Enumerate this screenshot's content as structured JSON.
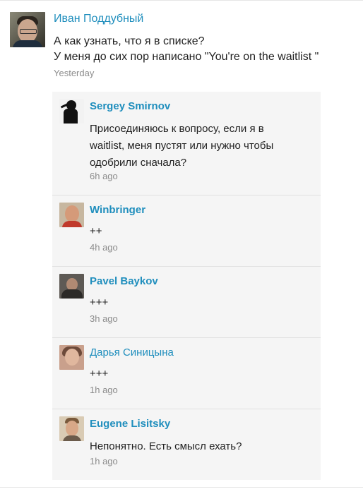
{
  "post": {
    "author": "Иван Поддубный",
    "lines": [
      "А как узнать, что я в списке?",
      "У меня до сих пор написано \"You're on the waitlist \""
    ],
    "time": "Yesterday"
  },
  "replies": [
    {
      "author": "Sergey Smirnov",
      "lines": [
        "Присоединяюсь к вопросу, если я в",
        "waitlist, меня пустят или нужно чтобы",
        "одобрили сначала?"
      ],
      "time": "6h ago"
    },
    {
      "author": "Winbringer",
      "lines": [
        "++"
      ],
      "time": "4h ago"
    },
    {
      "author": "Pavel Baykov",
      "lines": [
        "+++"
      ],
      "time": "3h ago"
    },
    {
      "author": "Дарья Синицына",
      "lines": [
        "+++"
      ],
      "time": "1h ago"
    },
    {
      "author": "Eugene Lisitsky",
      "lines": [
        "Непонятно. Есть смысл ехать?"
      ],
      "time": "1h ago"
    }
  ]
}
